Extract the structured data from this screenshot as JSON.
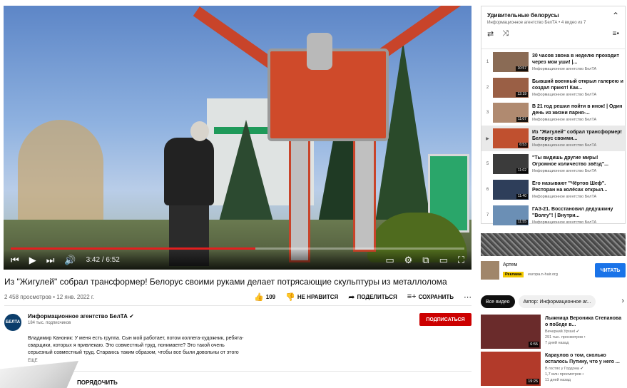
{
  "player": {
    "time": "3:42 / 6:52",
    "progress": 0.54,
    "controls": {
      "prev": "⏮",
      "play": "▶",
      "next": "⏭",
      "volume": "🔊",
      "subtitles": "▭",
      "settings": "⚙",
      "miniplayer": "⧉",
      "theater": "▭",
      "fullscreen": "⛶"
    }
  },
  "video": {
    "title": "Из \"Жигулей\" собрал трансформер! Белорус своими руками делает потрясающие скульптуры из металлолома",
    "stats": "2 458 просмотров • 12 янв. 2022 г.",
    "likes": "109",
    "dislike_label": "НЕ НРАВИТСЯ",
    "share_label": "ПОДЕЛИТЬСЯ",
    "save_label": "СОХРАНИТЬ",
    "more_icon": "⋯"
  },
  "channel": {
    "avatar_text": "БЕЛТА",
    "name": "Информационное агентство БелТА ✔",
    "subs": "184 тыс. подписчиков",
    "subscribe_label": "ПОДПИСАТЬСЯ"
  },
  "description": {
    "lines": [
      "Владимир Каноник: У меня есть группа. Сын мой работает, потом коллега-художник, ребята-",
      "сварщики, которых я привлекаю. Это совместный труд, понимаете? Это такой очень",
      "серьезный совместный труд. Стараюсь таким образом, чтобы все были довольны от этого"
    ],
    "more_label": "ЕЩЕ"
  },
  "comments": {
    "sort_label": "ПОРЯДОЧИТЬ"
  },
  "playlist": {
    "title": "Удивительные белорусы",
    "subtitle": "Информационное агентство БелТА • 4 видео из 7",
    "items": [
      {
        "index": "1",
        "title": "30 часов звона в неделю проходит через мои уши! |...",
        "channel": "Информационное агентство БелТА",
        "duration": "10:57",
        "thumb": "#8a6b55"
      },
      {
        "index": "2",
        "title": "Бывший военный открыл галерею и создал приют! Как...",
        "channel": "Информационное агентство БелТА",
        "duration": "12:19",
        "thumb": "#9a5f45"
      },
      {
        "index": "3",
        "title": "В 21 год решил пойти в инок! | Один день из жизни парня-...",
        "channel": "Информационное агентство БелТА",
        "duration": "11:07",
        "thumb": "#b08a70"
      },
      {
        "index": "▶",
        "title": "Из \"Жигулей\" собрал трансформер! Белорус своими...",
        "channel": "Информационное агентство БелТА",
        "duration": "6:53",
        "thumb": "#c0502f"
      },
      {
        "index": "5",
        "title": "\"Ты видишь другие миры! Огромное количество звёзд\"...",
        "channel": "Информационное агентство БелТА",
        "duration": "11:02",
        "thumb": "#3b3b3b"
      },
      {
        "index": "6",
        "title": "Его называют \"Чёртов Шеф\". Ресторан на колёсах открыл...",
        "channel": "Информационное агентство БелТА",
        "duration": "11:40",
        "thumb": "#2e3e5a"
      },
      {
        "index": "7",
        "title": "ГАЗ-21. Восстановил дедушкину \"Волгу\"! | Внутри...",
        "channel": "Информационное агентство БелТА",
        "duration": "11:55",
        "thumb": "#6b8fb5"
      }
    ]
  },
  "ad": {
    "name": "Артем",
    "badge": "Реклама",
    "url": "europa.n-hair.org",
    "button_label": "ЧИТАТЬ"
  },
  "chips": {
    "items": [
      "Все видео",
      "Автор: Информационное аг..."
    ],
    "next_icon": "›"
  },
  "recommended": [
    {
      "title": "Лыжница Вероника Степанова о победе в...",
      "channel": "Вечерний Урганt ✔",
      "views": "291 тыс. просмотров •",
      "age": "7 дней назад",
      "duration": "6:55",
      "thumb": "#6a2b2b"
    },
    {
      "title": "Караулов о том, сколько осталось Путину, что у него ...",
      "channel": "В гостях у Гордона ✔",
      "views": "1,7 млн просмотров •",
      "age": "11 дней назад",
      "duration": "19:25",
      "thumb": "#b23a2a"
    }
  ]
}
